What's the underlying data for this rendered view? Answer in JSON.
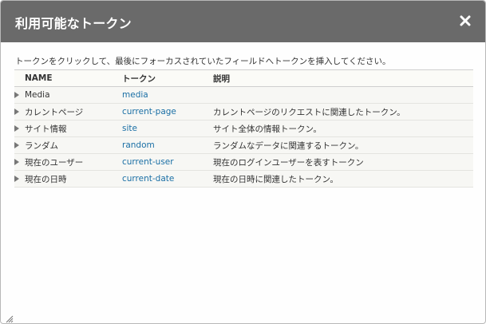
{
  "dialog": {
    "title": "利用可能なトークン",
    "close_icon": "close-icon",
    "description": "トークンをクリックして、最後にフォーカスされていたフィールドへトークンを挿入してください。"
  },
  "table": {
    "headers": [
      "NAME",
      "トークン",
      "説明"
    ],
    "rows": [
      {
        "name": "Media",
        "token": "media",
        "description": ""
      },
      {
        "name": "カレントページ",
        "token": "current-page",
        "description": "カレントページのリクエストに関連したトークン。"
      },
      {
        "name": "サイト情報",
        "token": "site",
        "description": "サイト全体の情報トークン。"
      },
      {
        "name": "ランダム",
        "token": "random",
        "description": "ランダムなデータに関連するトークン。"
      },
      {
        "name": "現在のユーザー",
        "token": "current-user",
        "description": "現在のログインユーザーを表すトークン"
      },
      {
        "name": "現在の日時",
        "token": "current-date",
        "description": "現在の日時に関連したトークン。"
      }
    ]
  }
}
